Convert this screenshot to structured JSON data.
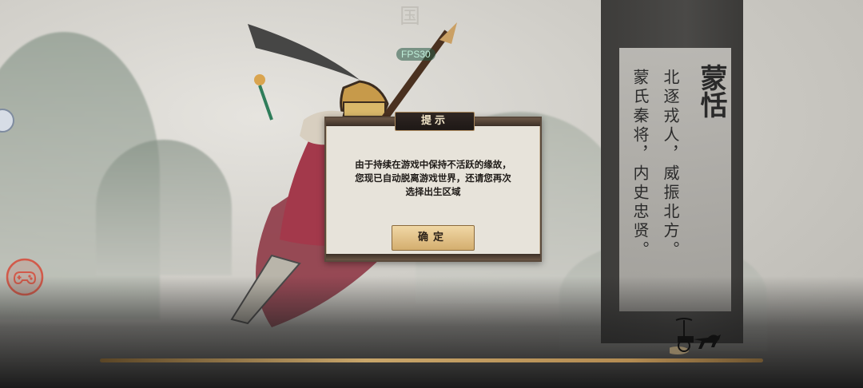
{
  "hud": {
    "fps": "FPS30"
  },
  "background": {
    "seal_char": "国"
  },
  "hero": {
    "name": "蒙恬",
    "verse_line_1": "北逐戎人，威振北方。",
    "verse_line_2": "蒙氏秦将，内史忠贤。"
  },
  "dialog": {
    "title": "提示",
    "message_lines": [
      "由于持续在游戏中保持不活跃的缘故，",
      "您现已自动脱离游戏世界，还请您再次",
      "选择出生区域"
    ],
    "confirm_label": "确定"
  },
  "colors": {
    "dialog_bg": "#e7e3da",
    "button": "#e2c38a",
    "panel": "#454442",
    "fps_text": "#bfeed9"
  },
  "icons": [
    "gamepad-icon",
    "circle-menu-icon",
    "chariot-icon"
  ]
}
